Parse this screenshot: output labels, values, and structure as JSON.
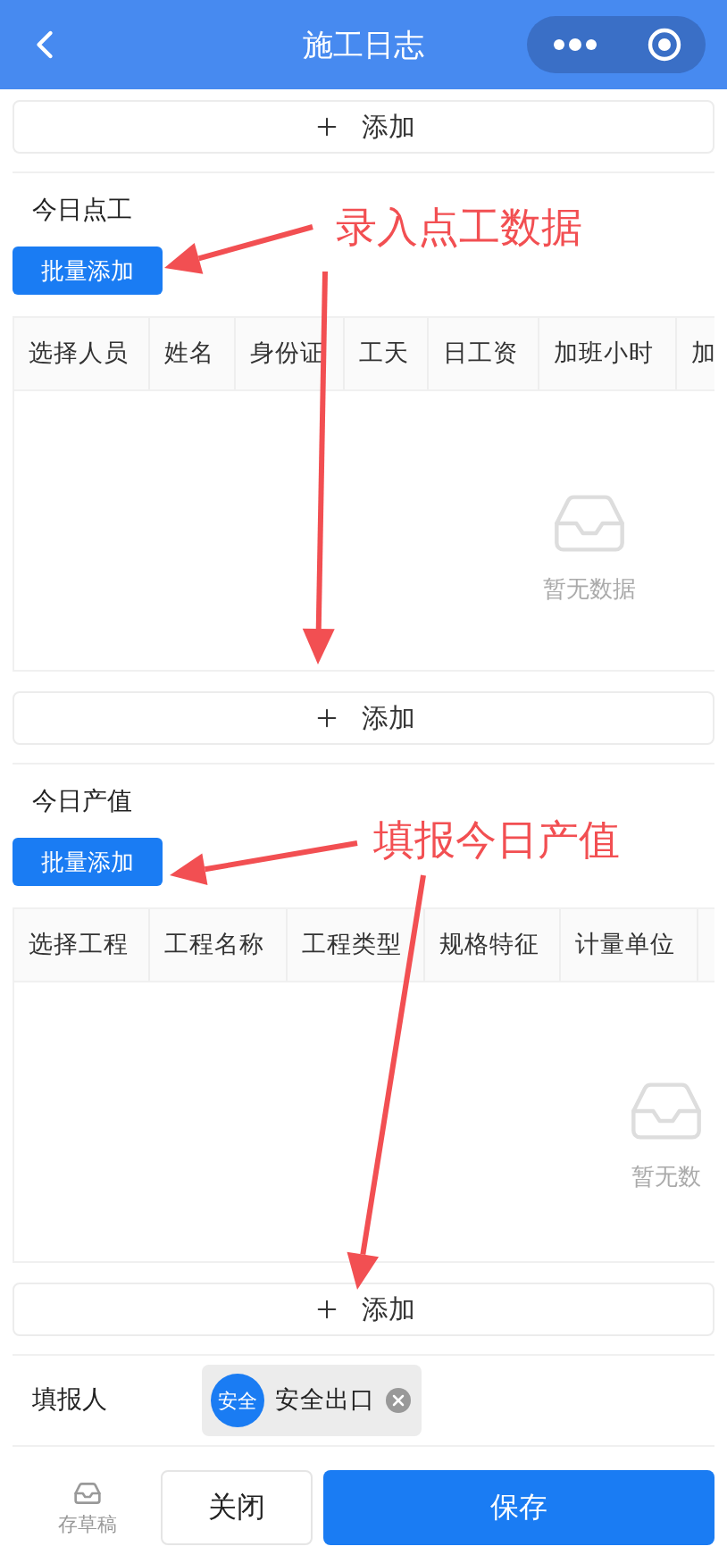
{
  "header": {
    "title": "施工日志"
  },
  "top_add": {
    "label": "添加"
  },
  "sections": [
    {
      "title": "今日点工",
      "batch_button": "批量添加",
      "columns": [
        "选择人员",
        "姓名",
        "身份证",
        "工天",
        "日工资",
        "加班小时",
        "加"
      ],
      "empty_text": "暂无数据",
      "add_label": "添加",
      "annotation": "录入点工数据"
    },
    {
      "title": "今日产值",
      "batch_button": "批量添加",
      "columns": [
        "选择工程",
        "工程名称",
        "工程类型",
        "规格特征",
        "计量单位"
      ],
      "empty_text": "暂无数",
      "add_label": "添加",
      "annotation": "填报今日产值"
    }
  ],
  "reporter": {
    "label": "填报人",
    "avatar": "安全",
    "name": "安全出口"
  },
  "footer": {
    "draft": "存草稿",
    "close": "关闭",
    "save": "保存"
  }
}
